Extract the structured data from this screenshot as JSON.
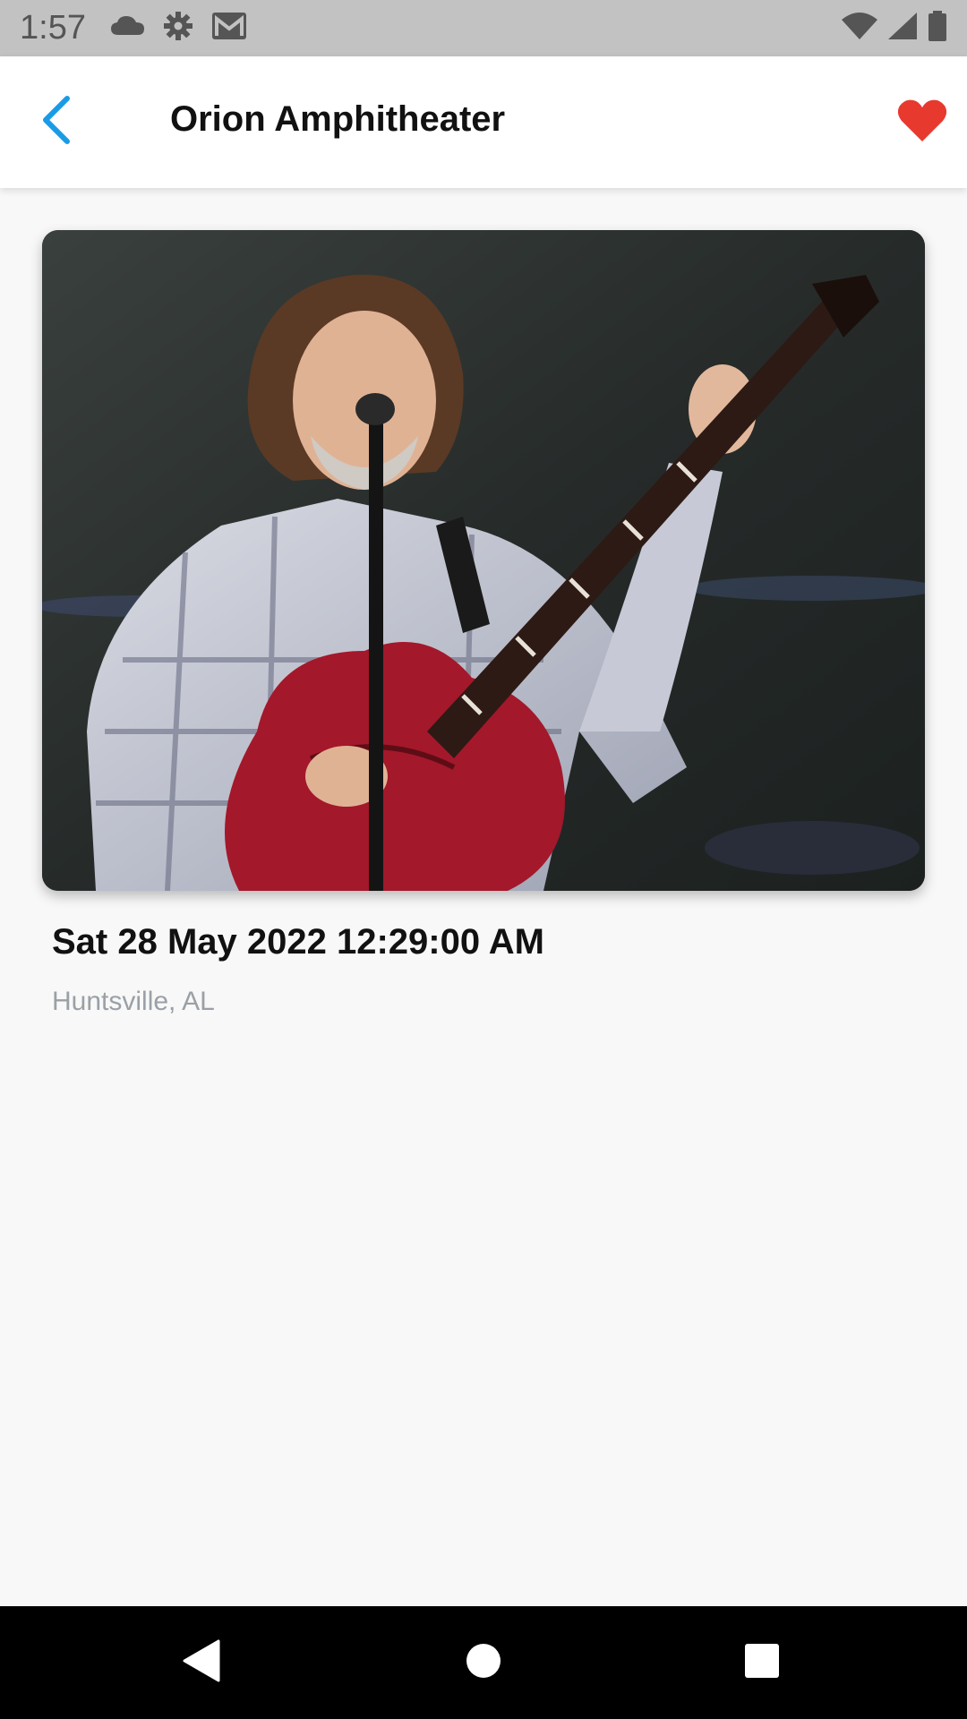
{
  "status_bar": {
    "time": "1:57",
    "left_icons": [
      "cloud-icon",
      "gear-icon",
      "gmail-icon"
    ],
    "right_icons": [
      "wifi-icon",
      "signal-icon",
      "battery-icon"
    ]
  },
  "app_bar": {
    "title": "Orion Amphitheater",
    "back_icon": "chevron-left-icon",
    "favorite_icon": "heart-icon",
    "accent_color": "#1a9be6",
    "favorite_color": "#e8392f"
  },
  "event": {
    "image_description_icon": "performer-photo",
    "date": "Sat 28 May 2022 12:29:00 AM",
    "location": "Huntsville, AL"
  },
  "nav_bar": {
    "buttons": [
      "back-triangle-icon",
      "home-circle-icon",
      "recents-square-icon"
    ]
  }
}
